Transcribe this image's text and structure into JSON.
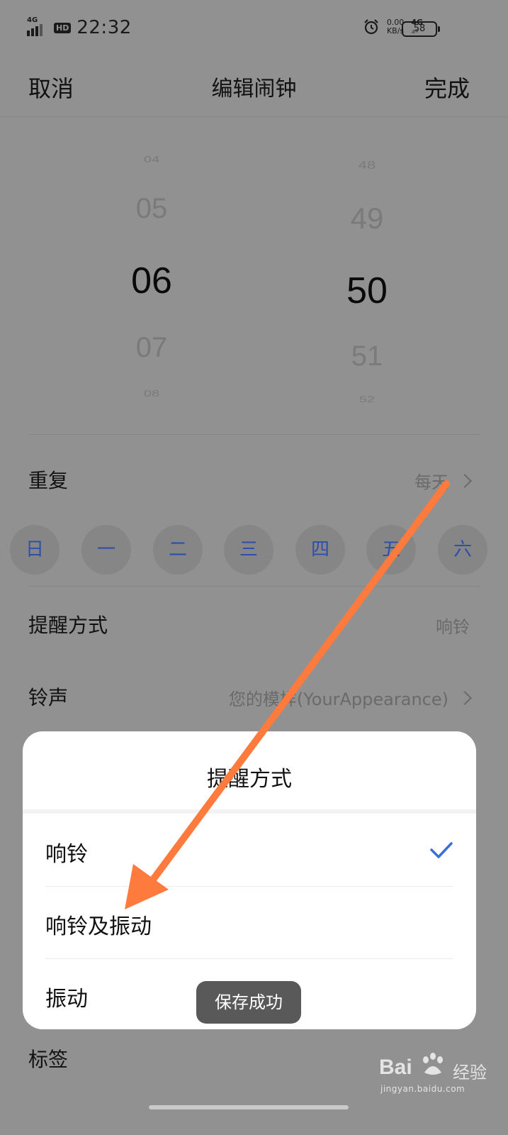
{
  "status_bar": {
    "network": "4G",
    "hd": "HD",
    "time": "22:32",
    "net_speed_value": "0.00",
    "net_speed_unit": "KB/s",
    "net_type": "4G",
    "battery": "58"
  },
  "header": {
    "cancel": "取消",
    "title": "编辑闹钟",
    "done": "完成"
  },
  "picker": {
    "hours": [
      "04",
      "05",
      "06",
      "07",
      "08"
    ],
    "minutes": [
      "48",
      "49",
      "50",
      "51",
      "52"
    ]
  },
  "repeat": {
    "label": "重复",
    "value": "每天"
  },
  "days": [
    "日",
    "一",
    "二",
    "三",
    "四",
    "五",
    "六"
  ],
  "reminder": {
    "label": "提醒方式",
    "value": "响铃"
  },
  "ringtone": {
    "label": "铃声",
    "value": "您的模样(YourAppearance)"
  },
  "tag": {
    "label": "标签"
  },
  "sheet": {
    "title": "提醒方式",
    "options": [
      "响铃",
      "响铃及振动",
      "振动"
    ],
    "selected_index": 0
  },
  "toast": "保存成功",
  "watermark": {
    "logo": "Bai",
    "cn": "经验",
    "url": "jingyan.baidu.com"
  },
  "colors": {
    "accent": "#3a6fd8",
    "annotation_arrow": "#ff7a3d"
  }
}
